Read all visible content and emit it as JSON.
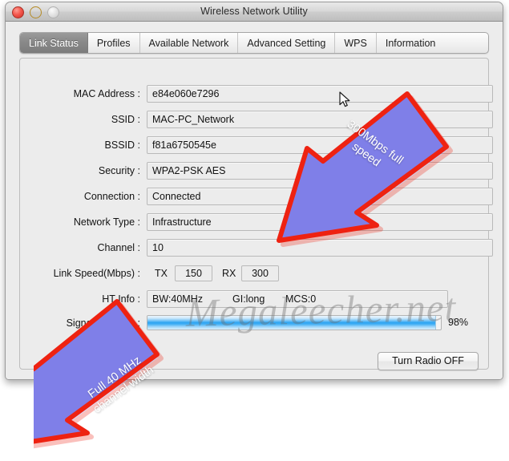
{
  "window": {
    "title": "Wireless Network Utility",
    "controls": [
      {
        "name": "close",
        "color": "#f4584e"
      },
      {
        "name": "minimize",
        "color": "#f3bf3e"
      },
      {
        "name": "zoom",
        "color": "#d8d8d8"
      }
    ]
  },
  "tabs": [
    {
      "label": "Link Status",
      "active": true
    },
    {
      "label": "Profiles",
      "active": false
    },
    {
      "label": "Available Network",
      "active": false
    },
    {
      "label": "Advanced Setting",
      "active": false
    },
    {
      "label": "WPS",
      "active": false
    },
    {
      "label": "Information",
      "active": false
    }
  ],
  "form": {
    "mac_address": {
      "label": "MAC Address :",
      "value": "e84e060e7296"
    },
    "ssid": {
      "label": "SSID :",
      "value": "MAC-PC_Network"
    },
    "bssid": {
      "label": "BSSID :",
      "value": "f81a6750545e"
    },
    "security": {
      "label": "Security :",
      "value": "WPA2-PSK AES"
    },
    "connection": {
      "label": "Connection :",
      "value": "Connected"
    },
    "network_type": {
      "label": "Network Type :",
      "value": "Infrastructure"
    },
    "channel": {
      "label": "Channel :",
      "value": "10"
    },
    "link_speed": {
      "label": "Link Speed(Mbps) :",
      "tx_label": "TX",
      "tx_value": "150",
      "rx_label": "RX",
      "rx_value": "300"
    },
    "ht_info": {
      "label": "HT Info :",
      "bw": "BW:40MHz",
      "gi": "GI:long",
      "mcs": "MCS:0"
    },
    "signal_strength": {
      "label": "Signal Strength :",
      "percent_text": "98%",
      "percent_value": 98,
      "bar_color": "#2aa3f2"
    }
  },
  "actions": {
    "turn_radio": "Turn Radio OFF"
  },
  "watermark": {
    "text": "Megaleecher.net"
  },
  "annotations": [
    {
      "id": "speed-callout",
      "text": "300Mbps full\nspeed",
      "fill": "#7f7fe8",
      "stroke": "#ee2211"
    },
    {
      "id": "bandwidth-callout",
      "text": "Full 40 MHz\nchannel width",
      "fill": "#7f7fe8",
      "stroke": "#ee2211"
    }
  ]
}
